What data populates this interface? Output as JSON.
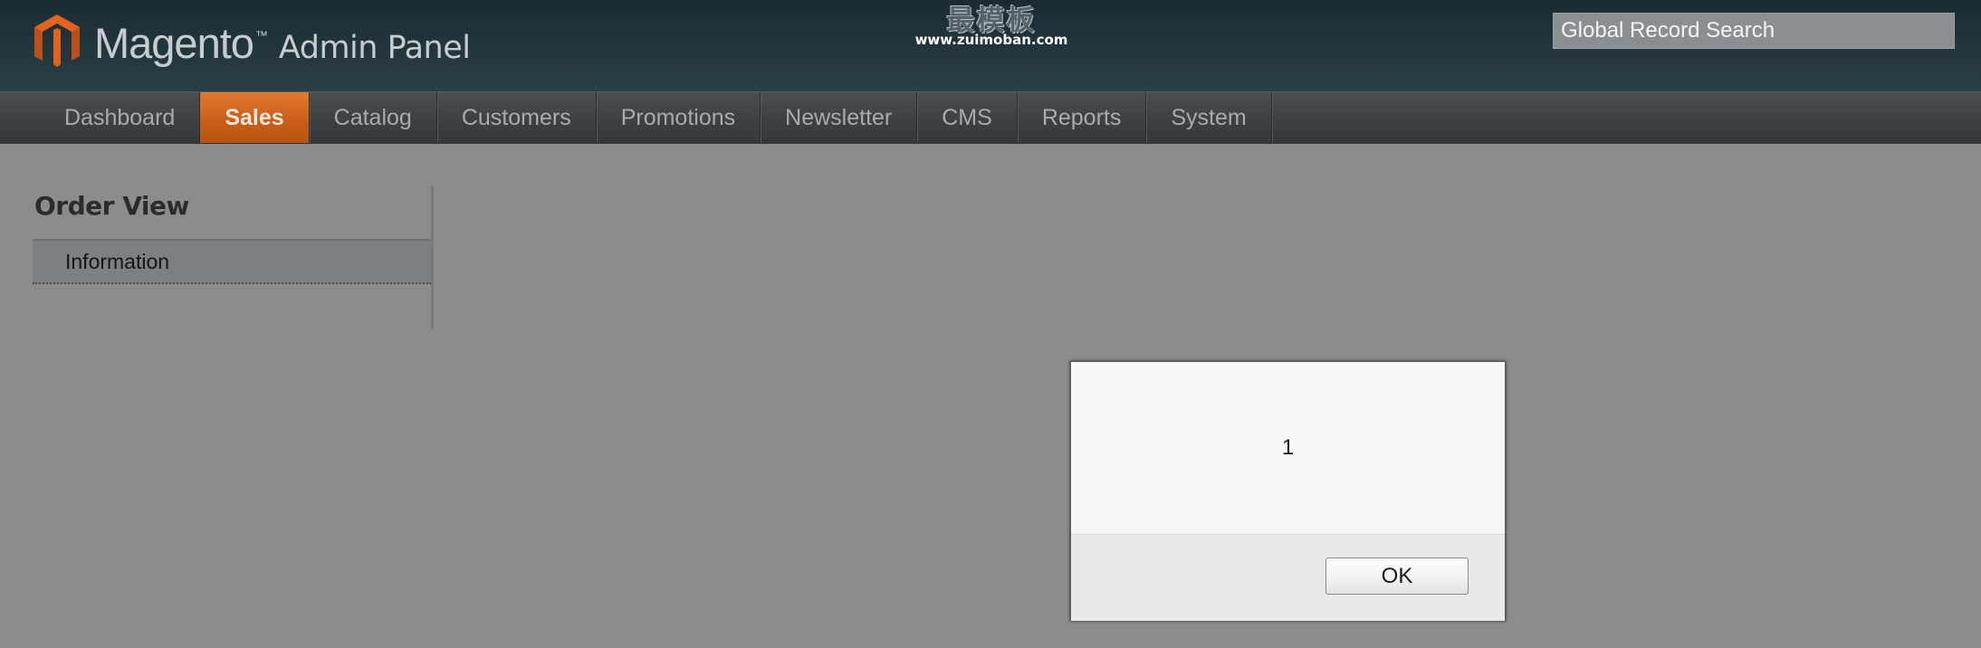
{
  "header": {
    "brand_name": "Magento",
    "brand_tm": "™",
    "brand_product": "Admin Panel",
    "watermark_mark": "最模板",
    "watermark_url": "www.zuimoban.com",
    "search_placeholder": "Global Record Search"
  },
  "nav": {
    "items": [
      {
        "label": "Dashboard"
      },
      {
        "label": "Sales"
      },
      {
        "label": "Catalog"
      },
      {
        "label": "Customers"
      },
      {
        "label": "Promotions"
      },
      {
        "label": "Newsletter"
      },
      {
        "label": "CMS"
      },
      {
        "label": "Reports"
      },
      {
        "label": "System"
      }
    ],
    "active": "Sales"
  },
  "sidebar": {
    "title": "Order View",
    "items": [
      {
        "label": "Information"
      }
    ]
  },
  "dialog": {
    "message": "1",
    "ok_label": "OK"
  },
  "colors": {
    "header_bg": "#1c2a31",
    "nav_bg": "#3e4244",
    "nav_active": "#d26a22",
    "page_bg": "#8c8c8c",
    "dialog_bg": "#f7f7f7"
  }
}
